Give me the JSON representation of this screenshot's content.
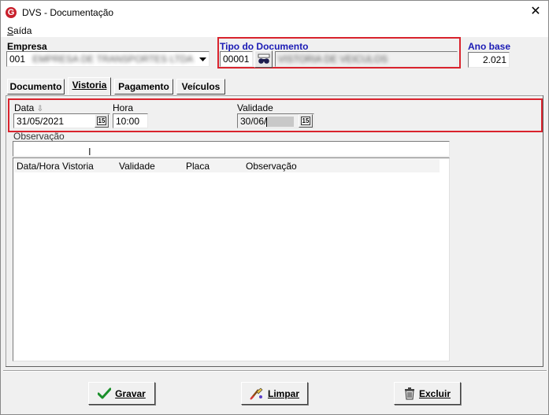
{
  "window": {
    "title": "DVS - Documentação",
    "close": "✕"
  },
  "menu": {
    "items": [
      {
        "label": "Saída",
        "accel": "S",
        "rest": "aída"
      }
    ]
  },
  "empresa": {
    "label": "Empresa",
    "code": "001",
    "name": "EMPRESA DE TRANSPORTES LTDA"
  },
  "tipo_documento": {
    "label": "Tipo do Documento",
    "code": "00001",
    "description": "VISTORIA DE VEICULOS"
  },
  "ano_base": {
    "label": "Ano base",
    "value": "2.021"
  },
  "tabs": [
    {
      "label": "Documento"
    },
    {
      "label": "Vistoria"
    },
    {
      "label": "Pagamento"
    },
    {
      "label": "Veículos"
    }
  ],
  "vistoria": {
    "data_label": "Data",
    "data_value": "31/05/2021",
    "hora_label": "Hora",
    "hora_value": "10:00",
    "validade_label": "Validade",
    "validade_value": "30/06/",
    "calendar_glyph": "15",
    "observacao_label": "Observação",
    "observacao_value": ""
  },
  "grid": {
    "columns": [
      "Data/Hora Vistoria",
      "Validade",
      "Placa",
      "Observação"
    ],
    "rows": []
  },
  "actions": {
    "gravar": {
      "label": "Gravar",
      "icon": "checkmark-icon"
    },
    "limpar": {
      "label": "Limpar",
      "icon": "eraser-icon"
    },
    "excluir": {
      "label": "Excluir",
      "icon": "trash-icon"
    }
  },
  "colors": {
    "highlight_box": "#d9232d",
    "blue_label": "#1b1bb5",
    "check_green": "#1a8f2a"
  }
}
